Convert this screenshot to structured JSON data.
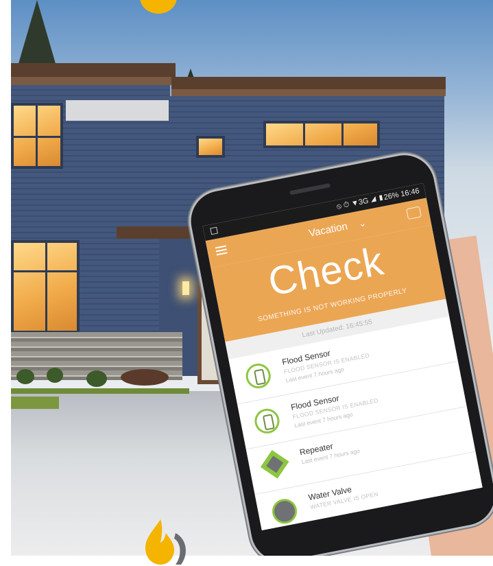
{
  "phone": {
    "statusbar": {
      "right": "⦸ ⏱ ▼3G ◢ ▮26% 16:46"
    },
    "appbar": {
      "mode": "Vacation",
      "chevron": "⌄"
    },
    "hero": {
      "title": "Check",
      "subtitle": "SOMETHING IS NOT WORKING PROPERLY"
    },
    "last_updated": "Last Updated: 16:45:55",
    "devices": [
      {
        "title": "Flood Sensor",
        "status": "FLOOD SENSOR IS ENABLED",
        "last": "Last event 7 hours ago",
        "icon": "flood-sensor-icon"
      },
      {
        "title": "Flood Sensor",
        "status": "FLOOD SENSOR IS ENABLED",
        "last": "Last event 7 hours ago",
        "icon": "flood-sensor-icon"
      },
      {
        "title": "Repeater",
        "status": "",
        "last": "Last event 7 hours ago",
        "icon": "repeater-icon"
      },
      {
        "title": "Water Valve",
        "status": "WATER VALVE IS OPEN",
        "last": "",
        "icon": "water-valve-icon"
      }
    ]
  },
  "colors": {
    "accent": "#eba654",
    "icon_green": "#8dc63f",
    "logo_yellow": "#f5b400",
    "logo_gray": "#6a6e73"
  }
}
